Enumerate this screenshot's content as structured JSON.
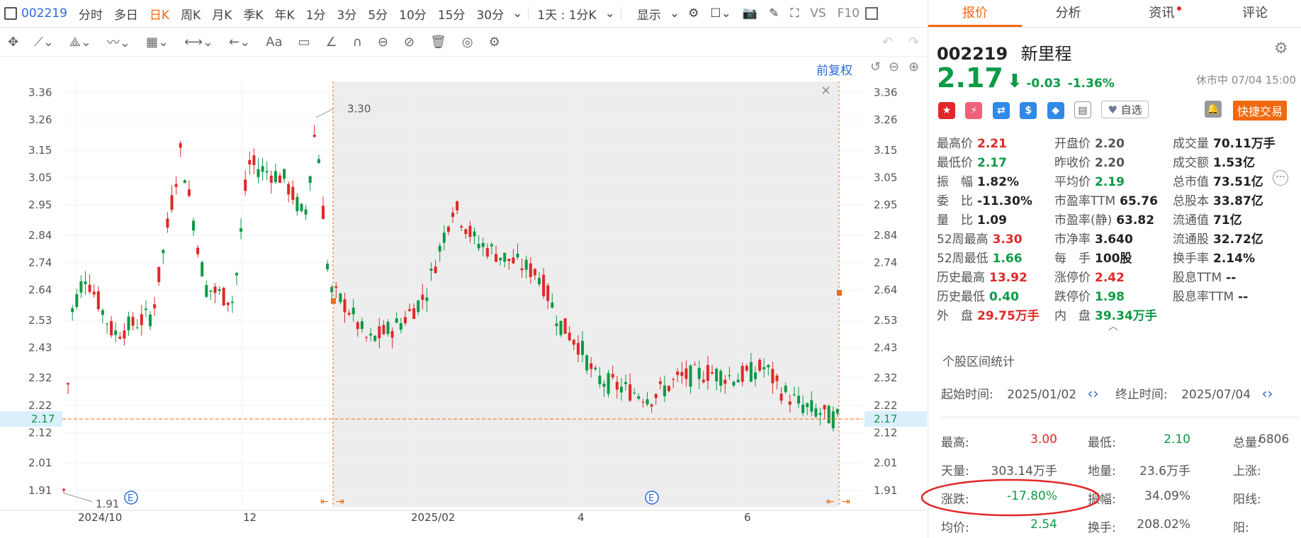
{
  "toolbar": {
    "code": "002219",
    "items": [
      "分时",
      "多日",
      "日K",
      "周K",
      "月K",
      "季K",
      "年K",
      "1分",
      "3分",
      "5分",
      "10分",
      "15分",
      "30分"
    ],
    "active": "日K",
    "period_select": "1天 : 1分K",
    "display": "显示",
    "vs": "VS",
    "f10": "F10"
  },
  "chart": {
    "restore_label": "前复权",
    "y_ticks": [
      "3.36",
      "3.26",
      "3.15",
      "3.05",
      "2.95",
      "2.84",
      "2.74",
      "2.64",
      "2.53",
      "2.43",
      "2.32",
      "2.22",
      "2.12",
      "2.01",
      "1.91"
    ],
    "current_price_label": "2.17",
    "x_ticks": [
      "2024/10",
      "12",
      "2025/02",
      "4",
      "6"
    ],
    "high_marker": "3.30",
    "low_marker": "1.91",
    "event_marker": "E",
    "close_label": "×"
  },
  "chart_data": {
    "type": "candlestick",
    "y_range": [
      1.85,
      3.4
    ],
    "x_ticks": [
      "2024/10",
      "12",
      "2025/02",
      "4",
      "6"
    ],
    "period_high": 3.3,
    "period_low": 1.91,
    "last": 2.17,
    "selection": {
      "start": "2025/01/02",
      "end": "2025/07/04"
    }
  },
  "tabs": [
    {
      "label": "报价",
      "active": true
    },
    {
      "label": "分析",
      "active": false
    },
    {
      "label": "资讯",
      "active": false,
      "dot": true
    },
    {
      "label": "评论",
      "active": false
    }
  ],
  "quote": {
    "code": "002219",
    "name": "新里程",
    "price": "2.17",
    "change": "-0.03",
    "change_pct": "-1.36%",
    "status": "休市中 07/04 15:00",
    "watch_label": "自选",
    "trade_label": "快捷交易"
  },
  "stats": {
    "col1": [
      {
        "label": "最高价",
        "value": "2.21",
        "color": "red"
      },
      {
        "label": "最低价",
        "value": "2.17",
        "color": "green"
      },
      {
        "label": "振　幅",
        "value": "1.82%",
        "color": "black"
      },
      {
        "label": "委　比",
        "value": "-11.30%",
        "color": "black"
      },
      {
        "label": "量　比",
        "value": "1.09",
        "color": "black"
      },
      {
        "label": "52周最高",
        "value": "3.30",
        "color": "red"
      },
      {
        "label": "52周最低",
        "value": "1.66",
        "color": "green"
      },
      {
        "label": "历史最高",
        "value": "13.92",
        "color": "red"
      },
      {
        "label": "历史最低",
        "value": "0.40",
        "color": "green"
      },
      {
        "label": "外　盘",
        "value": "29.75万手",
        "color": "red"
      }
    ],
    "col2": [
      {
        "label": "开盘价",
        "value": "2.20",
        "color": "gray"
      },
      {
        "label": "昨收价",
        "value": "2.20",
        "color": "gray"
      },
      {
        "label": "平均价",
        "value": "2.19",
        "color": "green"
      },
      {
        "label": "市盈率TTM",
        "value": "65.76",
        "color": "black"
      },
      {
        "label": "市盈率(静)",
        "value": "63.82",
        "color": "black"
      },
      {
        "label": "市净率",
        "value": "3.640",
        "color": "black"
      },
      {
        "label": "每　手",
        "value": "100股",
        "color": "black"
      },
      {
        "label": "涨停价",
        "value": "2.42",
        "color": "red"
      },
      {
        "label": "跌停价",
        "value": "1.98",
        "color": "green"
      },
      {
        "label": "内　盘",
        "value": "39.34万手",
        "color": "green"
      }
    ],
    "col3": [
      {
        "label": "成交量",
        "value": "70.11万手",
        "color": "black"
      },
      {
        "label": "成交额",
        "value": "1.53亿",
        "color": "black"
      },
      {
        "label": "总市值",
        "value": "73.51亿",
        "color": "black"
      },
      {
        "label": "总股本",
        "value": "33.87亿",
        "color": "black"
      },
      {
        "label": "流通值",
        "value": "71亿",
        "color": "black"
      },
      {
        "label": "流通股",
        "value": "32.72亿",
        "color": "black"
      },
      {
        "label": "换手率",
        "value": "2.14%",
        "color": "black"
      },
      {
        "label": "股息TTM",
        "value": "--",
        "color": "black"
      },
      {
        "label": "股息率TTM",
        "value": "--",
        "color": "black"
      }
    ]
  },
  "range": {
    "title": "个股区间统计",
    "start_label": "起始时间:",
    "start": "2025/01/02",
    "end_label": "终止时间:",
    "end": "2025/07/04",
    "rows": [
      [
        {
          "label": "最高:",
          "value": "3.00",
          "color": "red"
        },
        {
          "label": "最低:",
          "value": "2.10",
          "color": "green"
        },
        {
          "label": "总量:",
          "value": "6806",
          "color": "gray"
        }
      ],
      [
        {
          "label": "天量:",
          "value": "303.14万手",
          "color": "gray"
        },
        {
          "label": "地量:",
          "value": "23.6万手",
          "color": "gray"
        },
        {
          "label": "上涨:",
          "value": "",
          "color": "gray"
        }
      ],
      [
        {
          "label": "涨跌:",
          "value": "-17.80%",
          "color": "green"
        },
        {
          "label": "振幅:",
          "value": "34.09%",
          "color": "gray"
        },
        {
          "label": "阳线:",
          "value": "",
          "color": "gray"
        }
      ],
      [
        {
          "label": "均价:",
          "value": "2.54",
          "color": "green"
        },
        {
          "label": "换手:",
          "value": "208.02%",
          "color": "gray"
        },
        {
          "label": "阳:",
          "value": "",
          "color": "gray"
        }
      ]
    ]
  }
}
